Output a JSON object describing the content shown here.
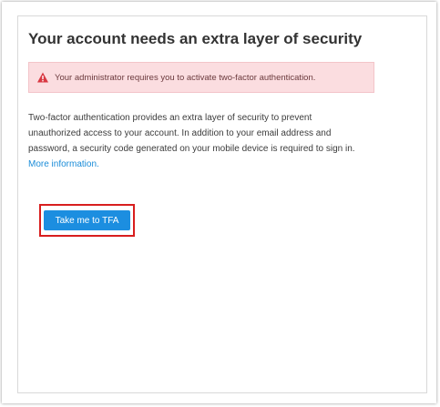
{
  "card": {
    "title": "Your account needs an extra layer of security"
  },
  "alert": {
    "icon": "warning-triangle-icon",
    "text": "Your administrator requires you to activate two-factor authentication.",
    "background_color": "#fbdde0",
    "icon_color": "#d93842"
  },
  "description": {
    "line1": "Two-factor authentication provides an extra layer of security to prevent",
    "line2": "unauthorized access to your account. In addition to your email address and",
    "line3": "password, a security code generated on your mobile device is required to sign in.",
    "link": "More information."
  },
  "actions": {
    "primary_label": "Take me to TFA",
    "primary_color": "#1c8ee0",
    "highlight_color": "#d81e1e"
  }
}
